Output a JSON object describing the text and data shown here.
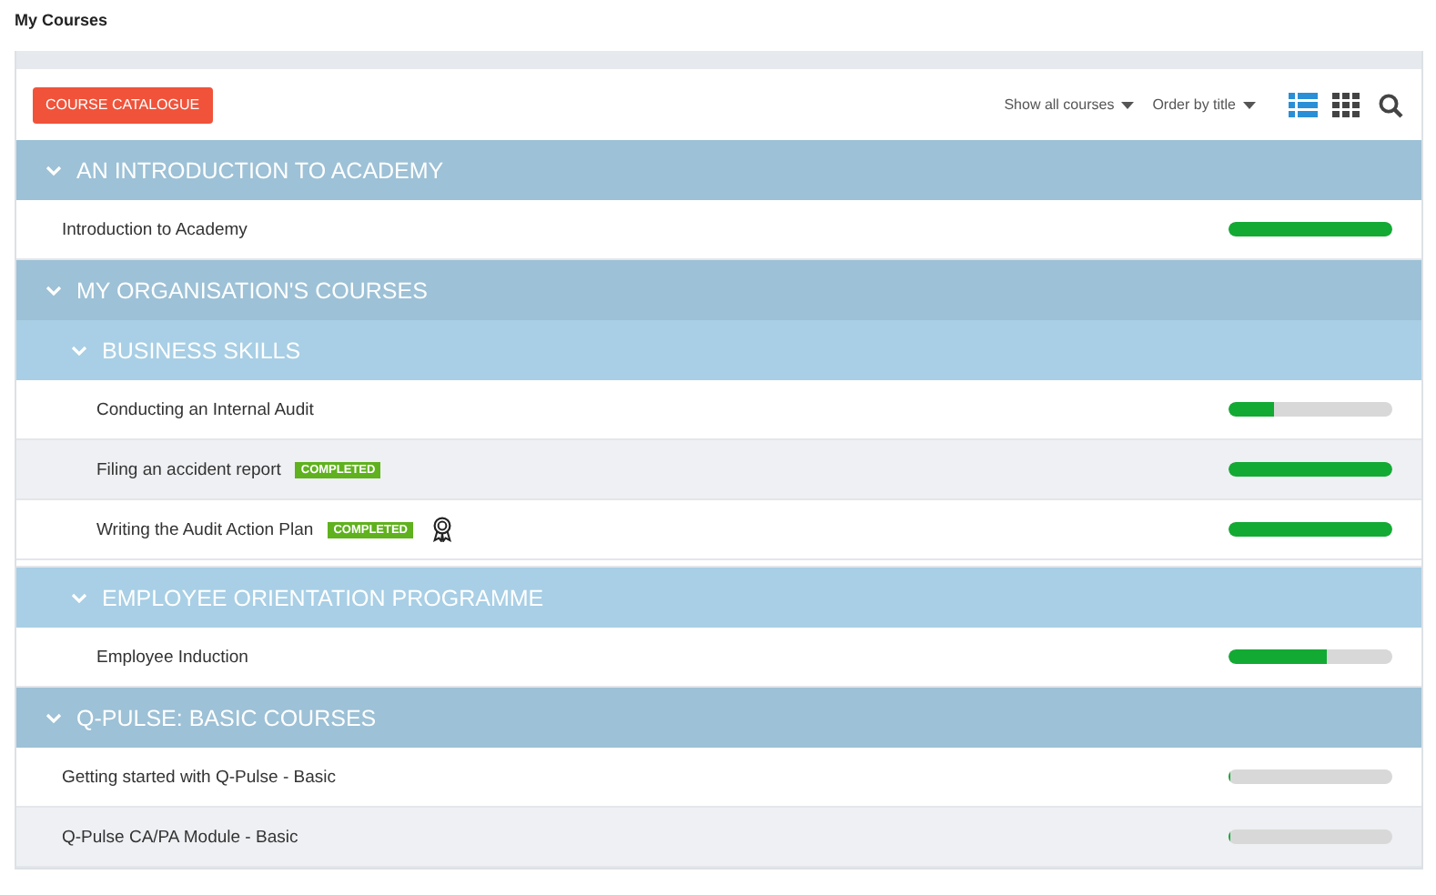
{
  "page_title": "My Courses",
  "toolbar": {
    "catalogue_button": "COURSE CATALOGUE",
    "filter": "Show all courses",
    "order": "Order by title",
    "views": [
      {
        "kind": "list",
        "selected": true
      },
      {
        "kind": "grid",
        "selected": false
      }
    ]
  },
  "sections": [
    {
      "kind": "group",
      "title": "AN INTRODUCTION TO ACADEMY",
      "expanded": true,
      "children": [
        {
          "kind": "course",
          "title": "Introduction to Academy",
          "level": 1,
          "highlighted": false
        }
      ]
    },
    {
      "kind": "group",
      "title": "MY ORGANISATION'S COURSES",
      "expanded": true,
      "children": [
        {
          "kind": "group",
          "title": "BUSINESS SKILLS",
          "expanded": true,
          "children": [
            {
              "kind": "course",
              "title": "Conducting an Internal Audit",
              "level": 0.28,
              "highlighted": false
            },
            {
              "kind": "course",
              "title": "Filing an accident report",
              "badge": "COMPLETED",
              "level": 1,
              "highlighted": true
            },
            {
              "kind": "course",
              "title": "Writing the Audit Action Plan",
              "badge": "COMPLETED",
              "certificate": true,
              "level": 1,
              "highlighted": false
            }
          ]
        },
        {
          "kind": "group",
          "title": "EMPLOYEE ORIENTATION PROGRAMME",
          "expanded": true,
          "children": [
            {
              "kind": "course",
              "title": "Employee Induction",
              "level": 0.6,
              "highlighted": false
            }
          ]
        }
      ]
    },
    {
      "kind": "group",
      "title": "Q-PULSE: BASIC COURSES",
      "expanded": true,
      "children": [
        {
          "kind": "course",
          "title": "Getting started with Q-Pulse - Basic",
          "level": 0,
          "highlighted": false
        },
        {
          "kind": "course",
          "title": "Q-Pulse CA/PA Module - Basic",
          "level": 0,
          "highlighted": true
        }
      ]
    }
  ]
}
